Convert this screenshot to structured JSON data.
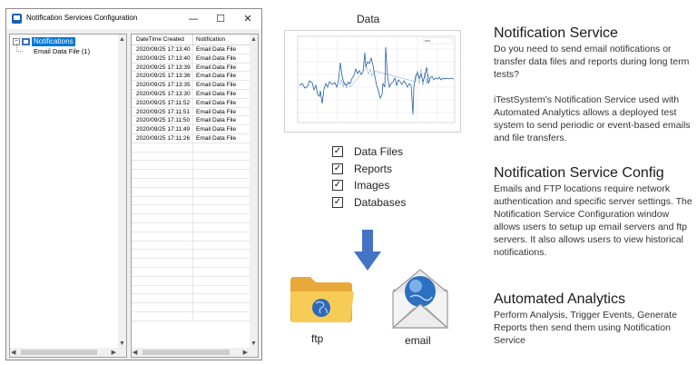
{
  "window": {
    "title": "Notification Services Configuration",
    "buttons": {
      "minimize": "—",
      "maximize": "☐",
      "close": "✕"
    },
    "tree": {
      "root_label": "Notifications",
      "expander": "−",
      "children": [
        "Email Data File (1)"
      ]
    },
    "list": {
      "columns": [
        "DateTime Created",
        "Notification"
      ],
      "rows": [
        [
          "2020/09/25 17:13:40",
          "Email Data File"
        ],
        [
          "2020/09/25 17:13:40",
          "Email Data File"
        ],
        [
          "2020/09/25 17:13:39",
          "Email Data File"
        ],
        [
          "2020/09/25 17:13:36",
          "Email Data File"
        ],
        [
          "2020/09/25 17:13:35",
          "Email Data File"
        ],
        [
          "2020/09/25 17:13:30",
          "Email Data File"
        ],
        [
          "2020/09/25 17:11:52",
          "Email Data File"
        ],
        [
          "2020/09/25 17:11:51",
          "Email Data File"
        ],
        [
          "2020/09/25 17:11:50",
          "Email Data File"
        ],
        [
          "2020/09/25 17:11:49",
          "Email Data File"
        ],
        [
          "2020/09/25 17:11:26",
          "Email Data File"
        ]
      ]
    }
  },
  "middle": {
    "data_heading": "Data",
    "checklist": [
      "Data Files",
      "Reports",
      "Images",
      "Databases"
    ],
    "check_mark": "✓",
    "ftp_label": "ftp",
    "email_label": "email"
  },
  "sections": [
    {
      "title": "Notification Service",
      "paragraphs": [
        "Do you need to send email notifications or transfer data files and reports during long term tests?",
        "iTestSystem’s Notification Service used with Automated Analytics allows a deployed test system to send periodic or event-based emails and file transfers."
      ]
    },
    {
      "title": "Notification Service Config",
      "paragraphs": [
        "Emails and FTP locations require network authentication and specific server settings.  The Notification Service Configuration window allows users to setup up email servers and ftp servers.  It also allows users to view historical notifications."
      ]
    },
    {
      "title": "Automated Analytics",
      "paragraphs": [
        "Perform Analysis, Trigger Events, Generate Reports then send them using Notification Service"
      ]
    }
  ],
  "colors": {
    "selection": "#0078d7",
    "arrow": "#4472c4",
    "folder": "#f4c542",
    "plot_line": "#1f5fa8"
  }
}
